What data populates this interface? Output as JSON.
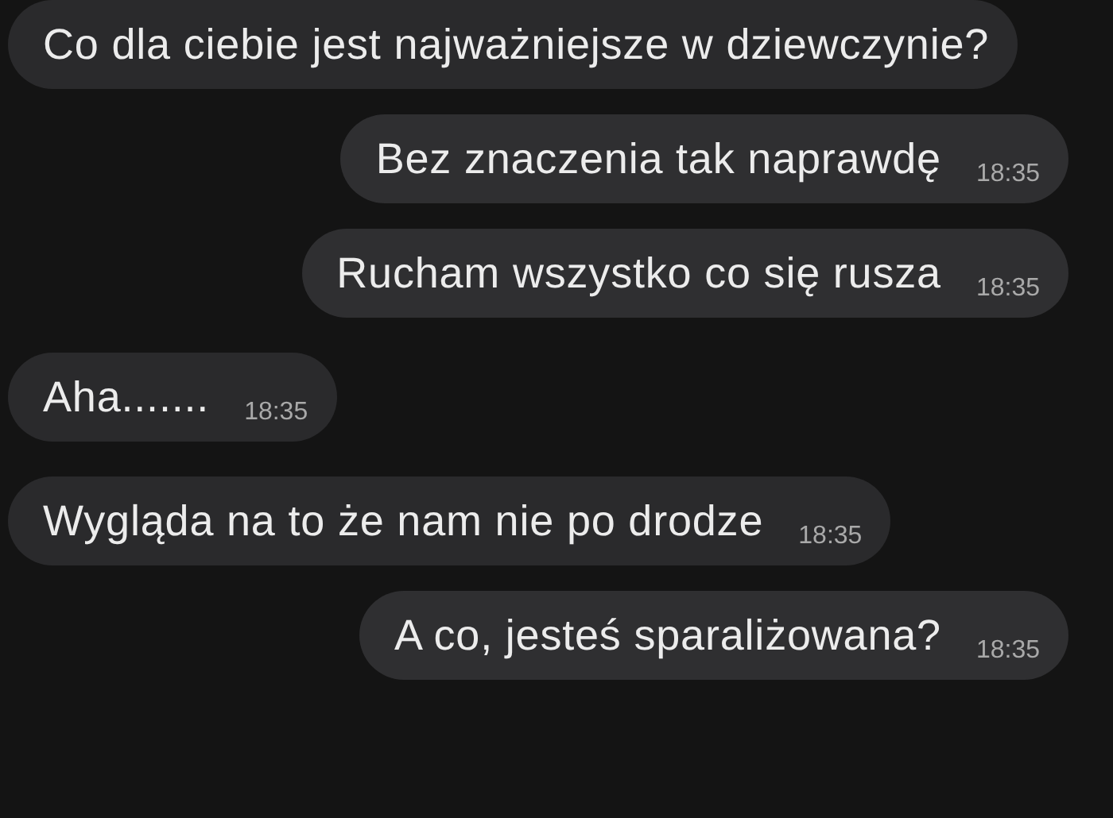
{
  "messages": [
    {
      "kind": "incoming",
      "text": "Co dla ciebie jest najważniejsze w dziewczynie?"
    },
    {
      "kind": "outgoing",
      "text": "Bez znaczenia tak naprawdę",
      "time": "18:35"
    },
    {
      "kind": "outgoing",
      "text": "Rucham wszystko co się rusza",
      "time": "18:35"
    },
    {
      "kind": "incoming",
      "text": "Aha.......",
      "time": "18:35"
    },
    {
      "kind": "incoming",
      "text": "Wygląda na to że nam nie po drodze",
      "time": "18:35"
    },
    {
      "kind": "outgoing",
      "text": "A co, jesteś sparaliżowana?",
      "time": "18:35"
    }
  ]
}
